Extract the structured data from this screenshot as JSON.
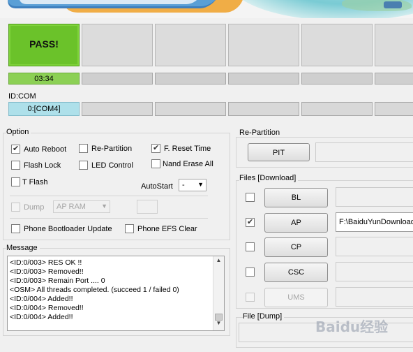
{
  "status": {
    "pass_label": "PASS!",
    "progress_time": "03:34",
    "id_com_label": "ID:COM",
    "com_port": "0:[COM4]"
  },
  "option": {
    "title": "Option",
    "auto_reboot": "Auto Reboot",
    "re_partition": "Re-Partition",
    "f_reset_time": "F. Reset Time",
    "flash_lock": "Flash Lock",
    "led_control": "LED Control",
    "nand_erase_all": "Nand Erase All",
    "t_flash": "T Flash",
    "autostart_label": "AutoStart",
    "autostart_value": "-",
    "dump": "Dump",
    "dump_target": "AP RAM",
    "phone_bootloader_update": "Phone Bootloader Update",
    "phone_efs_clear": "Phone EFS Clear"
  },
  "message": {
    "title": "Message",
    "lines": [
      "<ID:0/003> RES OK !!",
      "<ID:0/003> Removed!!",
      "<ID:0/003> Remain Port ....  0",
      "<OSM> All threads completed. (succeed 1 / failed 0)",
      "<ID:0/004> Added!!",
      "<ID:0/004> Removed!!",
      "<ID:0/004> Added!!"
    ]
  },
  "repartition": {
    "title": "Re-Partition",
    "pit_button": "PIT"
  },
  "files": {
    "title": "Files [Download]",
    "bl_button": "BL",
    "ap_button": "AP",
    "ap_path": "F:\\BaiduYunDownload\\",
    "cp_button": "CP",
    "csc_button": "CSC",
    "ums_button": "UMS"
  },
  "file_dump": {
    "title": "File [Dump]"
  },
  "watermark": "Baidu经验",
  "colors": {
    "pass_green": "#6bc22a",
    "progress_green": "#8cd055",
    "com_active": "#aee0ea"
  }
}
